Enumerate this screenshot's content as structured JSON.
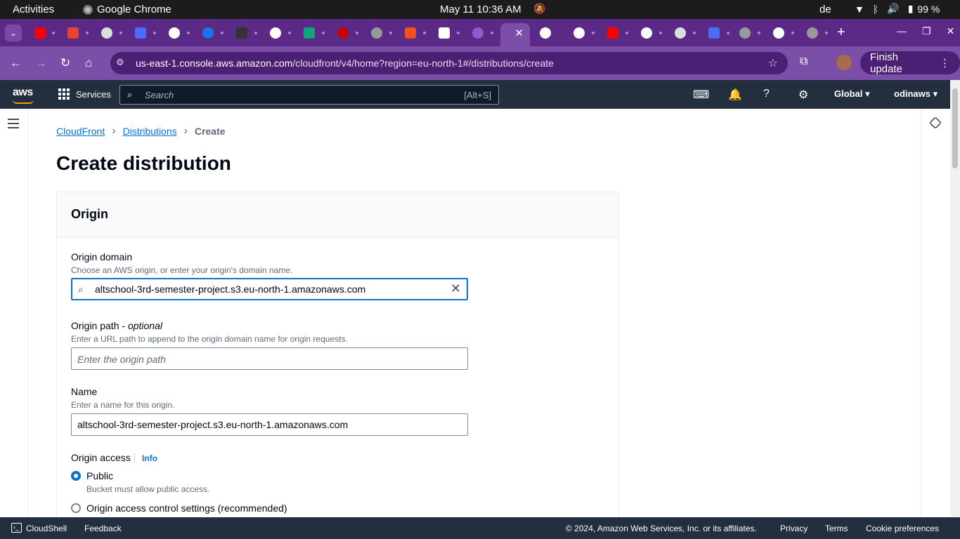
{
  "system_bar": {
    "activities": "Activities",
    "app_name": "Google Chrome",
    "clock": "May 11  10:36 AM",
    "keyboard_layout": "de",
    "battery": "99 %",
    "icons": [
      "notifications-muted-icon",
      "wifi-icon",
      "bluetooth-icon",
      "volume-icon",
      "battery-icon"
    ]
  },
  "browser": {
    "tab_count_visible": 24,
    "url_host": "us-east-1.console.aws.amazon.com",
    "url_path": "/cloudfront/v4/home?region=eu-north-1#/distributions/create",
    "finish_update_label": "Finish update"
  },
  "aws_header": {
    "logo": "aws",
    "services_label": "Services",
    "search_placeholder": "Search",
    "search_shortcut": "[Alt+S]",
    "region_label": "Global",
    "account_label": "odinaws"
  },
  "breadcrumb": {
    "items": [
      "CloudFront",
      "Distributions",
      "Create"
    ]
  },
  "page": {
    "title": "Create distribution"
  },
  "origin_panel": {
    "heading": "Origin",
    "origin_domain": {
      "label": "Origin domain",
      "description": "Choose an AWS origin, or enter your origin's domain name.",
      "value": "altschool-3rd-semester-project.s3.eu-north-1.amazonaws.com"
    },
    "origin_path": {
      "label": "Origin path - ",
      "label_optional": "optional",
      "description": "Enter a URL path to append to the origin domain name for origin requests.",
      "placeholder": "Enter the origin path",
      "value": ""
    },
    "name": {
      "label": "Name",
      "description": "Enter a name for this origin.",
      "value": "altschool-3rd-semester-project.s3.eu-north-1.amazonaws.com"
    },
    "origin_access": {
      "label": "Origin access",
      "info_link": "Info",
      "options": [
        {
          "label": "Public",
          "description": "Bucket must allow public access.",
          "selected": true
        },
        {
          "label": "Origin access control settings (recommended)",
          "selected": false
        }
      ]
    }
  },
  "footer": {
    "cloudshell": "CloudShell",
    "feedback": "Feedback",
    "copyright": "© 2024, Amazon Web Services, Inc. or its affiliates.",
    "privacy": "Privacy",
    "terms": "Terms",
    "cookie_preferences": "Cookie preferences"
  },
  "colors": {
    "aws_header_bg": "#232f3e",
    "aws_orange": "#ff9900",
    "link_blue": "#0972d3",
    "chrome_theme": "#7b4fa8"
  }
}
